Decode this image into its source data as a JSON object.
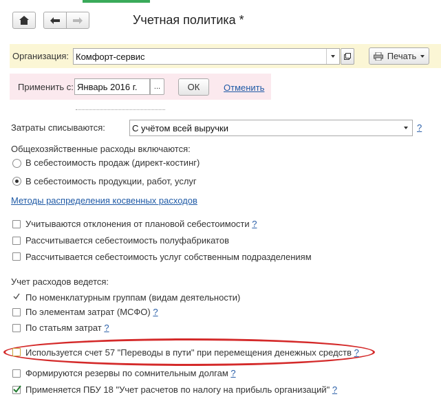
{
  "title": "Учетная политика *",
  "nav": {
    "home_icon": "home-icon",
    "back_icon": "arrow-left-icon",
    "forward_icon": "arrow-right-icon"
  },
  "org_bar": {
    "label": "Организация:",
    "value": "Комфорт-сервис",
    "print_label": "Печать"
  },
  "apply_bar": {
    "label": "Применить с:",
    "value": "Январь 2016 г.",
    "ellipsis": "...",
    "ok_label": "ОК",
    "cancel_label": "Отменить"
  },
  "costs": {
    "label": "Затраты списываются:",
    "value": "С учётом всей выручки",
    "help": "?"
  },
  "overhead": {
    "heading": "Общехозяйственные расходы включаются:",
    "options": [
      {
        "label": "В себестоимость продаж (директ-костинг)",
        "selected": false
      },
      {
        "label": "В  себестоимость продукции, работ, услуг",
        "selected": true
      }
    ],
    "methods_link": "Методы распределения косвенных расходов"
  },
  "checks1": [
    {
      "label": "Учитываются отклонения от плановой себестоимости",
      "help": "?",
      "checked": false
    },
    {
      "label": "Рассчитывается себестоимость полуфабрикатов",
      "help": "",
      "checked": false
    },
    {
      "label": "Рассчитывается себестоимость услуг собственным подразделениям",
      "help": "",
      "checked": false
    }
  ],
  "expenses": {
    "heading": "Учет расходов ведется:",
    "items": [
      {
        "label": "По номенклатурным группам (видам деятельности)",
        "help": "",
        "checked": true,
        "style": "mark"
      },
      {
        "label": "По элементам затрат (МСФО)",
        "help": "?",
        "checked": false
      },
      {
        "label": "По статьям затрат",
        "help": "?",
        "checked": false
      }
    ]
  },
  "checks2": [
    {
      "label": "Используется счет 57 \"Переводы в пути\" при перемещения денежных средств",
      "help": "?",
      "checked": false,
      "highlighted": true
    },
    {
      "label": "Формируются резервы по сомнительным долгам",
      "help": "?",
      "checked": false
    },
    {
      "label": "Применяется ПБУ 18 \"Учет расчетов по налогу на прибыль организаций\"",
      "help": "?",
      "checked": true
    }
  ],
  "colors": {
    "org_bar_bg": "#fbf6d5",
    "apply_bar_bg": "#fbe9ee",
    "highlight_ring": "#d42a2a",
    "link": "#1f5aa6",
    "tab_accent": "#3aaa5a"
  }
}
